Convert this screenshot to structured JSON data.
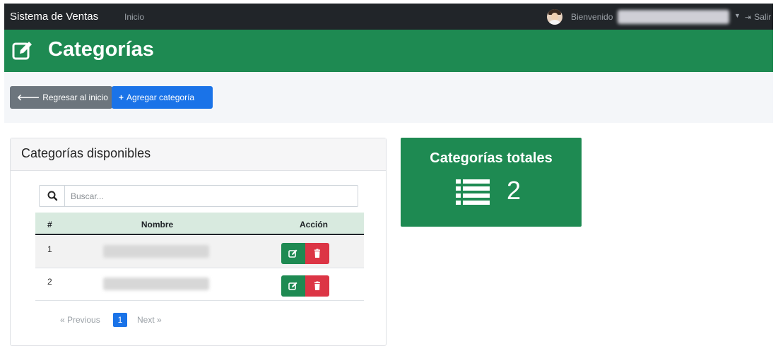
{
  "navbar": {
    "brand": "Sistema de Ventas",
    "home_link": "Inicio",
    "welcome_label": "Bienvenido",
    "logout_label": "Salir"
  },
  "header": {
    "title": "Categorías",
    "icon": "edit-square-icon"
  },
  "toolbar": {
    "back_label": "Regresar al inicio",
    "back_icon": "arrow-left-icon",
    "add_label": "Agregar categoría",
    "add_icon": "plus-icon"
  },
  "card": {
    "title": "Categorías disponibles",
    "search": {
      "placeholder": "Buscar...",
      "value": "",
      "icon": "search-icon"
    },
    "columns": [
      "#",
      "Nombre",
      "Acción"
    ],
    "rows": [
      {
        "num": "1"
      },
      {
        "num": "2"
      }
    ],
    "pagination": {
      "prev_label": "« Previous",
      "current_page": "1",
      "next_label": "Next »"
    }
  },
  "stat": {
    "title": "Categorías totales",
    "value": "2",
    "icon": "list-icon"
  },
  "colors": {
    "navbar": "#212529",
    "primary_green": "#1e8a52",
    "primary_blue": "#1a73e8",
    "secondary_gray": "#6c757d",
    "danger_red": "#dc3545",
    "table_header": "#d8eadf"
  }
}
